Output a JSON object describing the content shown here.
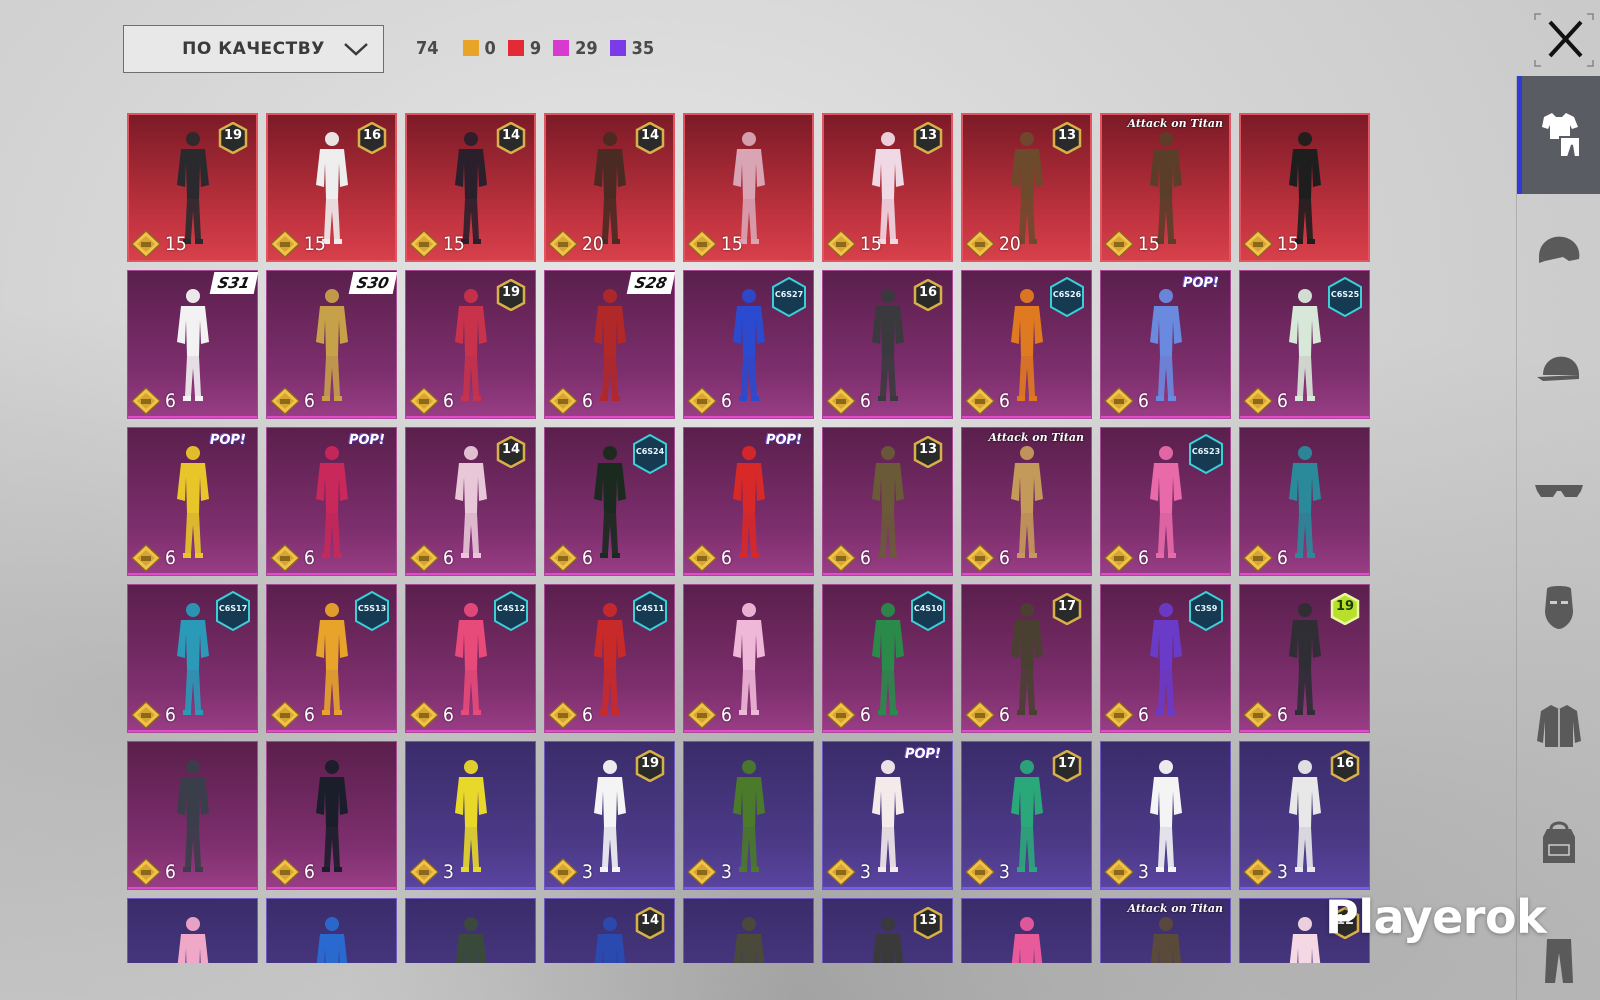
{
  "sort": {
    "label": "ПО КАЧЕСТВУ"
  },
  "counts": {
    "total": "74",
    "items": [
      {
        "value": "0",
        "color": "#e8a426"
      },
      {
        "value": "9",
        "color": "#e42b35"
      },
      {
        "value": "29",
        "color": "#d83ad0"
      },
      {
        "value": "35",
        "color": "#7b3ce8"
      }
    ]
  },
  "sidebar": {
    "items": [
      {
        "icon": "outfit-icon",
        "active": true
      },
      {
        "icon": "helmet-icon"
      },
      {
        "icon": "cap-icon"
      },
      {
        "icon": "glasses-icon"
      },
      {
        "icon": "mask-icon"
      },
      {
        "icon": "jacket-icon"
      },
      {
        "icon": "backpack-icon"
      },
      {
        "icon": "pants-icon"
      }
    ]
  },
  "grid": {
    "rows": [
      [
        {
          "q": "red",
          "badge": {
            "type": "num",
            "text": "19"
          },
          "price": "15",
          "c": "#2a2a2e"
        },
        {
          "q": "red",
          "badge": {
            "type": "num",
            "text": "16"
          },
          "price": "15",
          "c": "#eeeeee"
        },
        {
          "q": "red",
          "badge": {
            "type": "num",
            "text": "14"
          },
          "price": "15",
          "c": "#2b1f2c"
        },
        {
          "q": "red",
          "badge": {
            "type": "num",
            "text": "14"
          },
          "price": "20",
          "c": "#4a2a22"
        },
        {
          "q": "red",
          "badge": null,
          "price": "15",
          "c": "#d9a4b4"
        },
        {
          "q": "red",
          "badge": {
            "type": "num",
            "text": "13"
          },
          "price": "15",
          "c": "#f0d8e4"
        },
        {
          "q": "red",
          "badge": {
            "type": "num",
            "text": "13"
          },
          "price": "20",
          "c": "#6e4a2c"
        },
        {
          "q": "red",
          "badge": {
            "type": "text",
            "text": "Attack on Titan"
          },
          "price": "15",
          "c": "#5b3e2a"
        },
        {
          "q": "red",
          "badge": null,
          "price": "15",
          "c": "#1e1e1e"
        }
      ],
      [
        {
          "q": "pink",
          "badge": {
            "type": "season",
            "text": "S31"
          },
          "price": "6",
          "c": "#f2f2f2"
        },
        {
          "q": "pink",
          "badge": {
            "type": "season",
            "text": "S30"
          },
          "price": "6",
          "c": "#c7a04a"
        },
        {
          "q": "pink",
          "badge": {
            "type": "num",
            "text": "19"
          },
          "price": "6",
          "c": "#c8324a"
        },
        {
          "q": "pink",
          "badge": {
            "type": "season",
            "text": "S28"
          },
          "price": "6",
          "c": "#b02828"
        },
        {
          "q": "pink",
          "badge": {
            "type": "code",
            "text": "C6S27"
          },
          "price": "6",
          "c": "#2a4ad0"
        },
        {
          "q": "pink",
          "badge": {
            "type": "num",
            "text": "16"
          },
          "price": "6",
          "c": "#3a3a3e"
        },
        {
          "q": "pink",
          "badge": {
            "type": "code",
            "text": "C6S26"
          },
          "price": "6",
          "c": "#e07a20"
        },
        {
          "q": "pink",
          "badge": {
            "type": "pop",
            "text": "POP!"
          },
          "price": "6",
          "c": "#6a8ae0"
        },
        {
          "q": "pink",
          "badge": {
            "type": "code",
            "text": "C6S25"
          },
          "price": "6",
          "c": "#d8e8d8"
        }
      ],
      [
        {
          "q": "pink",
          "badge": {
            "type": "pop",
            "text": "POP!"
          },
          "price": "6",
          "c": "#e8c62a"
        },
        {
          "q": "pink",
          "badge": {
            "type": "pop",
            "text": "POP!"
          },
          "price": "6",
          "c": "#c8285a"
        },
        {
          "q": "pink",
          "badge": {
            "type": "num",
            "text": "14"
          },
          "price": "6",
          "c": "#e8c8d8"
        },
        {
          "q": "pink",
          "badge": {
            "type": "code",
            "text": "C6S24"
          },
          "price": "6",
          "c": "#1a2a1e"
        },
        {
          "q": "pink",
          "badge": {
            "type": "pop",
            "text": "POP!"
          },
          "price": "6",
          "c": "#d82828"
        },
        {
          "q": "pink",
          "badge": {
            "type": "num",
            "text": "13"
          },
          "price": "6",
          "c": "#6a5a38"
        },
        {
          "q": "pink",
          "badge": {
            "type": "text",
            "text": "Attack on Titan"
          },
          "price": "6",
          "c": "#c49a5a"
        },
        {
          "q": "pink",
          "badge": {
            "type": "code",
            "text": "C6S23"
          },
          "price": "6",
          "c": "#e86aa8"
        },
        {
          "q": "pink",
          "badge": null,
          "price": "6",
          "c": "#2a8a9a"
        }
      ],
      [
        {
          "q": "pink",
          "badge": {
            "type": "code",
            "text": "C6S17"
          },
          "price": "6",
          "c": "#2a9ab8"
        },
        {
          "q": "pink",
          "badge": {
            "type": "code",
            "text": "C5S13"
          },
          "price": "6",
          "c": "#e8a42a"
        },
        {
          "q": "pink",
          "badge": {
            "type": "code",
            "text": "C4S12"
          },
          "price": "6",
          "c": "#e84a7a"
        },
        {
          "q": "pink",
          "badge": {
            "type": "code",
            "text": "C4S11"
          },
          "price": "6",
          "c": "#c82a2a"
        },
        {
          "q": "pink",
          "badge": null,
          "price": "6",
          "c": "#f0b8d8"
        },
        {
          "q": "pink",
          "badge": {
            "type": "code",
            "text": "C4S10"
          },
          "price": "6",
          "c": "#2a8a4a"
        },
        {
          "q": "pink",
          "badge": {
            "type": "num",
            "text": "17"
          },
          "price": "6",
          "c": "#4a4032"
        },
        {
          "q": "pink",
          "badge": {
            "type": "code",
            "text": "C3S9"
          },
          "price": "6",
          "c": "#6a3ac8"
        },
        {
          "q": "pink",
          "badge": {
            "type": "num-green",
            "text": "19"
          },
          "price": "6",
          "c": "#2e2e34"
        }
      ],
      [
        {
          "q": "pink",
          "badge": null,
          "price": "6",
          "c": "#3a3e4a"
        },
        {
          "q": "pink",
          "badge": null,
          "price": "6",
          "c": "#1a1e2a"
        },
        {
          "q": "purple",
          "badge": null,
          "price": "3",
          "c": "#e8d82a"
        },
        {
          "q": "purple",
          "badge": {
            "type": "num",
            "text": "19"
          },
          "price": "3",
          "c": "#f4f4f4"
        },
        {
          "q": "purple",
          "badge": null,
          "price": "3",
          "c": "#4a7a2a"
        },
        {
          "q": "purple",
          "badge": {
            "type": "pop",
            "text": "POP!"
          },
          "price": "3",
          "c": "#f4eaea"
        },
        {
          "q": "purple",
          "badge": {
            "type": "num",
            "text": "17"
          },
          "price": "3",
          "c": "#2aa87a"
        },
        {
          "q": "purple",
          "badge": null,
          "price": "3",
          "c": "#f4f4f4"
        },
        {
          "q": "purple",
          "badge": {
            "type": "num",
            "text": "16"
          },
          "price": "3",
          "c": "#e8e8e8"
        }
      ],
      [
        {
          "q": "purple",
          "badge": null,
          "price": "",
          "c": "#f0a8c8"
        },
        {
          "q": "purple",
          "badge": null,
          "price": "",
          "c": "#2a6ad0"
        },
        {
          "q": "purple",
          "badge": null,
          "price": "",
          "c": "#3a4a3a"
        },
        {
          "q": "purple",
          "badge": {
            "type": "num",
            "text": "14"
          },
          "price": "",
          "c": "#2a4ab0"
        },
        {
          "q": "purple",
          "badge": null,
          "price": "",
          "c": "#4a4a3a"
        },
        {
          "q": "purple",
          "badge": {
            "type": "num",
            "text": "13"
          },
          "price": "",
          "c": "#3a3a3a"
        },
        {
          "q": "purple",
          "badge": null,
          "price": "",
          "c": "#e85a9a"
        },
        {
          "q": "purple",
          "badge": {
            "type": "text",
            "text": "Attack on Titan"
          },
          "price": "",
          "c": "#5a4a3a"
        },
        {
          "q": "purple",
          "badge": {
            "type": "num",
            "text": "12"
          },
          "price": "",
          "c": "#f4d8e4"
        }
      ]
    ]
  },
  "watermark": "Playerok"
}
